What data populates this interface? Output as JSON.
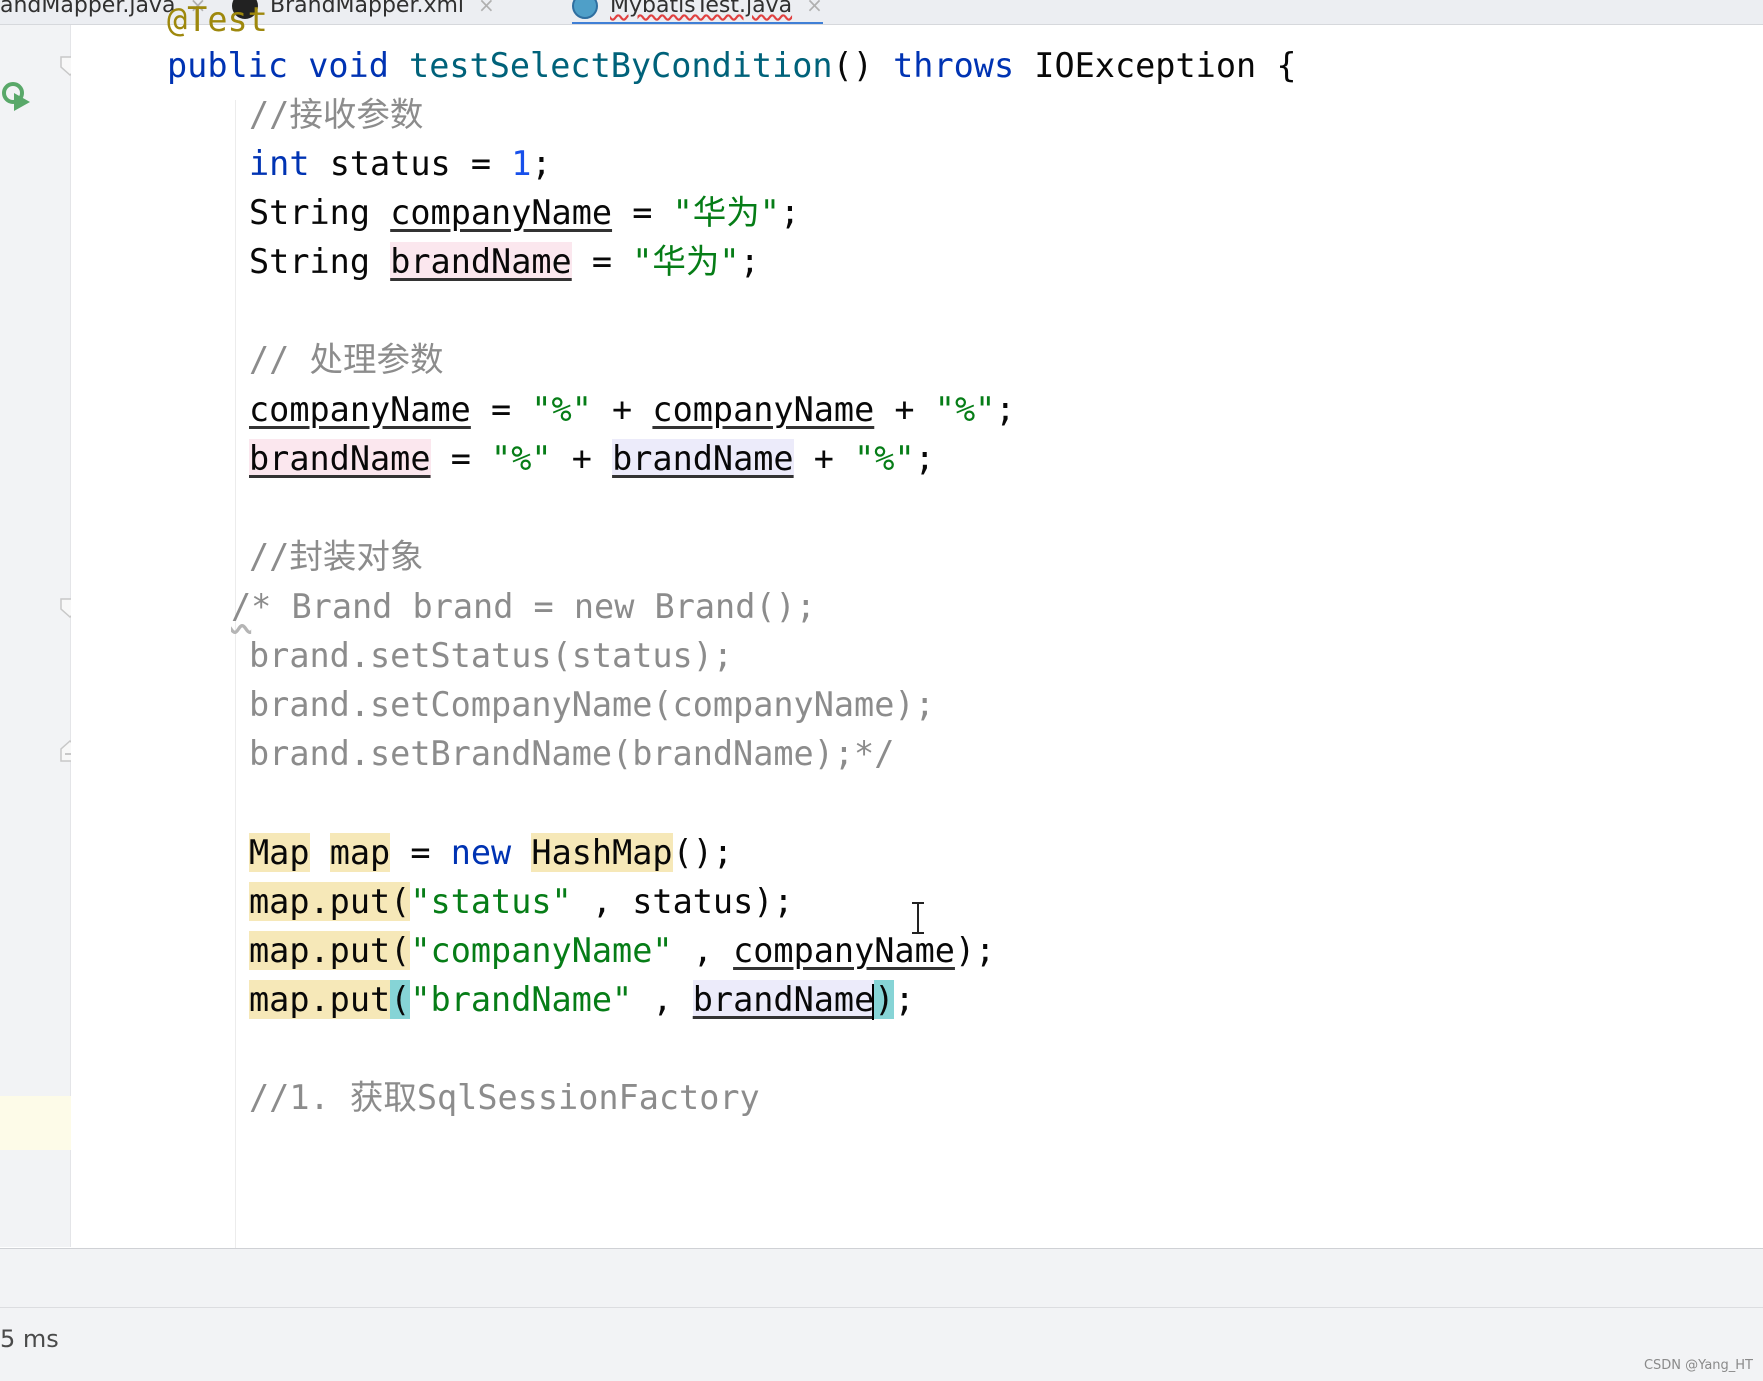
{
  "tabs": [
    {
      "label": "andMapper.java",
      "close": "×"
    },
    {
      "label": "BrandMapper.xml",
      "close": "×"
    },
    {
      "label": "MybatisTest.java",
      "close": "×"
    }
  ],
  "code": {
    "annotation": "@Test",
    "signature": {
      "kw1": "public",
      "kw2": "void",
      "method": "testSelectByCondition",
      "parens": "()",
      "throws": "throws",
      "rest": "IOException {"
    },
    "c_receive": "//接收参数",
    "l_status": {
      "kw": "int",
      "rest1": "status = ",
      "num": "1",
      "end": ";"
    },
    "l_company": {
      "type": "String",
      "var": "companyName",
      "eq": " = ",
      "str": "\"华为\"",
      "end": ";"
    },
    "l_brand": {
      "type": "String",
      "var": "brandName",
      "eq": " = ",
      "str": "\"华为\"",
      "end": ";"
    },
    "c_process": "// 处理参数",
    "l_proc1": {
      "var": "companyName",
      "eq": " = ",
      "s1": "\"%\"",
      "plus1": " + ",
      "var2": "companyName",
      "plus2": " + ",
      "s2": "\"%\"",
      "end": ";"
    },
    "l_proc2": {
      "var": "brandName",
      "eq": " = ",
      "s1": "\"%\"",
      "plus1": " + ",
      "var2": "brandName",
      "plus2": " + ",
      "s2": "\"%\"",
      "end": ";"
    },
    "c_wrap": "//封装对象",
    "bc1_start": "/",
    "bc1_rest": "* Brand brand = new Brand();",
    "bc2": "brand.setStatus(status);",
    "bc3": "brand.setCompanyName(companyName);",
    "bc4": "brand.setBrandName(brandName);*/",
    "l_map": {
      "t1": "Map",
      "t2": "map",
      "eq": " = ",
      "kw": "new",
      "t3": "HashMap",
      "end": "();"
    },
    "l_put1": {
      "pre": "map.put(",
      "str": "\"status\"",
      "mid": " , ",
      "arg": "status",
      "end": ");"
    },
    "l_put2": {
      "pre": "map.put(",
      "str": "\"companyName\"",
      "mid": " , ",
      "arg": "companyName",
      "end": ");"
    },
    "l_put3": {
      "pre": "map.put",
      "paren": "(",
      "str": "\"brandName\"",
      "mid": " , ",
      "arg": "brandName",
      "cparen": ")",
      "end": ";"
    },
    "c_step1": "//1. 获取SqlSessionFactory"
  },
  "status": {
    "elapsed": "5 ms"
  },
  "watermark": "CSDN @Yang_HT",
  "colors": {
    "keyword": "#0033b3",
    "string": "#067d17",
    "comment": "#8c8c8c",
    "number": "#1750eb",
    "method": "#00627a",
    "accent": "#3f7fd6"
  }
}
